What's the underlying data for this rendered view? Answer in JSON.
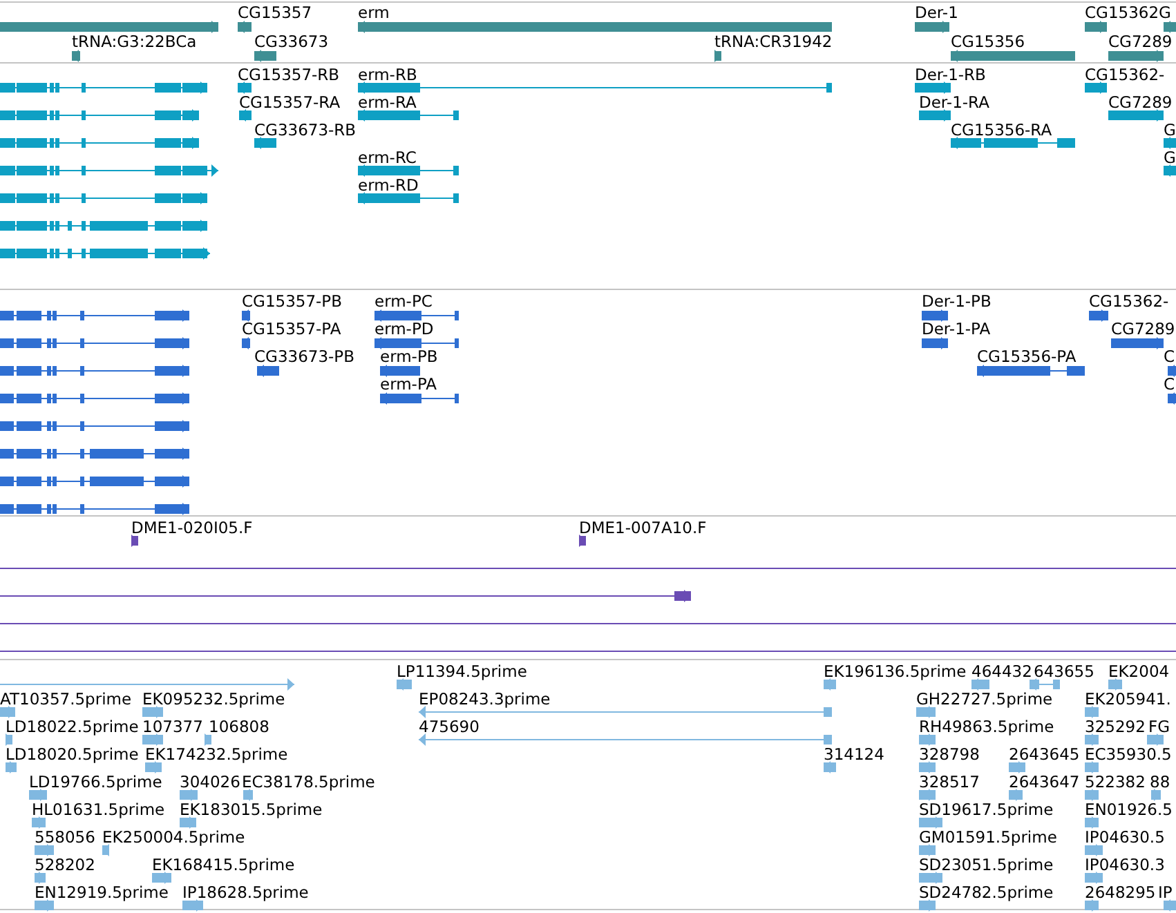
{
  "tracks": [
    {
      "kind": "gene",
      "features": [
        {
          "reverse": false
        },
        {
          "label": "tRNA:G3:22BCa",
          "reverse": true
        },
        {
          "label": "CG15357",
          "reverse": true
        },
        {
          "label": "CG33673",
          "reverse": true
        },
        {
          "label": "erm",
          "reverse": true
        },
        {
          "label": "tRNA:CR31942",
          "reverse": false
        },
        {
          "label": "Der-1",
          "reverse": false
        },
        {
          "label": "CG15356",
          "reverse": true
        },
        {
          "label": "CG15362G",
          "reverse": false
        },
        {
          "label": "CG7289",
          "reverse": false
        },
        {
          "reverse": true
        }
      ]
    },
    {
      "kind": "transcript",
      "features": [
        {
          "reverse": false
        },
        {
          "reverse": false
        },
        {
          "reverse": false
        },
        {
          "reverse": false
        },
        {
          "reverse": false
        },
        {
          "reverse": false
        },
        {
          "reverse": false
        },
        {
          "label": "CG15357-RB",
          "reverse": true
        },
        {
          "label": "CG15357-RA",
          "reverse": true
        },
        {
          "label": "CG33673-RB",
          "reverse": true
        },
        {
          "label": "erm-RB",
          "reverse": true
        },
        {
          "label": "erm-RA",
          "reverse": true
        },
        {
          "label": "erm-RC",
          "reverse": true
        },
        {
          "label": "erm-RD",
          "reverse": true
        },
        {
          "label": "Der-1-RB",
          "reverse": false
        },
        {
          "label": "Der-1-RA",
          "reverse": false
        },
        {
          "label": "CG15356-RA",
          "reverse": true
        },
        {
          "label": "CG15362-",
          "reverse": false
        },
        {
          "label": "CG7289",
          "reverse": false
        },
        {
          "label": "G",
          "reverse": true
        },
        {
          "label": "G",
          "reverse": true
        }
      ]
    },
    {
      "kind": "protein",
      "features": [
        {
          "reverse": false
        },
        {
          "reverse": false
        },
        {
          "reverse": false
        },
        {
          "reverse": false
        },
        {
          "reverse": false
        },
        {
          "reverse": false
        },
        {
          "reverse": false
        },
        {
          "reverse": false
        },
        {
          "label": "CG15357-PB",
          "reverse": true
        },
        {
          "label": "CG15357-PA",
          "reverse": true
        },
        {
          "label": "CG33673-PB",
          "reverse": true
        },
        {
          "label": "erm-PC",
          "reverse": true
        },
        {
          "label": "erm-PD",
          "reverse": true
        },
        {
          "label": "erm-PB",
          "reverse": true
        },
        {
          "label": "erm-PA",
          "reverse": true
        },
        {
          "label": "Der-1-PB",
          "reverse": false
        },
        {
          "label": "Der-1-PA",
          "reverse": false
        },
        {
          "label": "CG15356-PA",
          "reverse": true
        },
        {
          "label": "CG15362-",
          "reverse": false
        },
        {
          "label": "CG7289",
          "reverse": false
        },
        {
          "label": "C",
          "reverse": true
        },
        {
          "label": "C",
          "reverse": true
        }
      ]
    },
    {
      "kind": "clone",
      "features": [
        {
          "label": "DME1-020I05.F",
          "reverse": false
        },
        {
          "label": "DME1-007A10.F",
          "reverse": false
        },
        {
          "reverse": false
        }
      ]
    },
    {
      "kind": "est",
      "features": [
        {
          "reverse": false
        },
        {
          "label": "LP11394.5prime",
          "reverse": true
        },
        {
          "label": "EK196136.5prime",
          "reverse": true
        },
        {
          "label": "464432",
          "reverse": true
        },
        {
          "label": "643655",
          "reverse": true
        },
        {
          "label": "EK2004",
          "reverse": false
        },
        {
          "label": "AT10357.5prime",
          "reverse": false
        },
        {
          "label": "EK095232.5prime",
          "reverse": false
        },
        {
          "label": "EP08243.3prime",
          "reverse": true
        },
        {
          "label": "GH22727.5prime",
          "reverse": false
        },
        {
          "label": "EK205941.",
          "reverse": false
        },
        {
          "label": "LD18022.5prime",
          "reverse": false
        },
        {
          "label": "107377",
          "reverse": false
        },
        {
          "label": "106808",
          "reverse": false
        },
        {
          "label": "475690",
          "reverse": true
        },
        {
          "label": "RH49863.5prime",
          "reverse": false
        },
        {
          "label": "325292",
          "reverse": false
        },
        {
          "label": "FG",
          "reverse": false
        },
        {
          "label": "LD18020.5prime",
          "reverse": false
        },
        {
          "label": "EK174232.5prime",
          "reverse": false
        },
        {
          "label": "314124",
          "reverse": true
        },
        {
          "label": "328798",
          "reverse": false
        },
        {
          "label": "2643645",
          "reverse": false
        },
        {
          "label": "EC35930.5",
          "reverse": false
        },
        {
          "label": "LD19766.5prime",
          "reverse": false
        },
        {
          "label": "304026",
          "reverse": false
        },
        {
          "label": "EC38178.5prime",
          "reverse": true
        },
        {
          "label": "328517",
          "reverse": false
        },
        {
          "label": "2643647",
          "reverse": false
        },
        {
          "label": "522382",
          "reverse": false
        },
        {
          "label": "88",
          "reverse": false
        },
        {
          "label": "HL01631.5prime",
          "reverse": false
        },
        {
          "label": "EK183015.5prime",
          "reverse": false
        },
        {
          "label": "SD19617.5prime",
          "reverse": false
        },
        {
          "label": "EN01926.5",
          "reverse": false
        },
        {
          "label": "558056",
          "reverse": false
        },
        {
          "label": "EK250004.5prime",
          "reverse": true
        },
        {
          "label": "GM01591.5prime",
          "reverse": false
        },
        {
          "label": "IP04630.5",
          "reverse": false
        },
        {
          "label": "528202",
          "reverse": false
        },
        {
          "label": "EK168415.5prime",
          "reverse": false
        },
        {
          "label": "SD23051.5prime",
          "reverse": false
        },
        {
          "label": "IP04630.3",
          "reverse": false
        },
        {
          "label": "EN12919.5prime",
          "reverse": false
        },
        {
          "label": "IP18628.5prime",
          "reverse": false
        },
        {
          "label": "SD24782.5prime",
          "reverse": false
        },
        {
          "label": "2648295",
          "reverse": false
        },
        {
          "label": "IP",
          "reverse": true
        }
      ]
    }
  ]
}
